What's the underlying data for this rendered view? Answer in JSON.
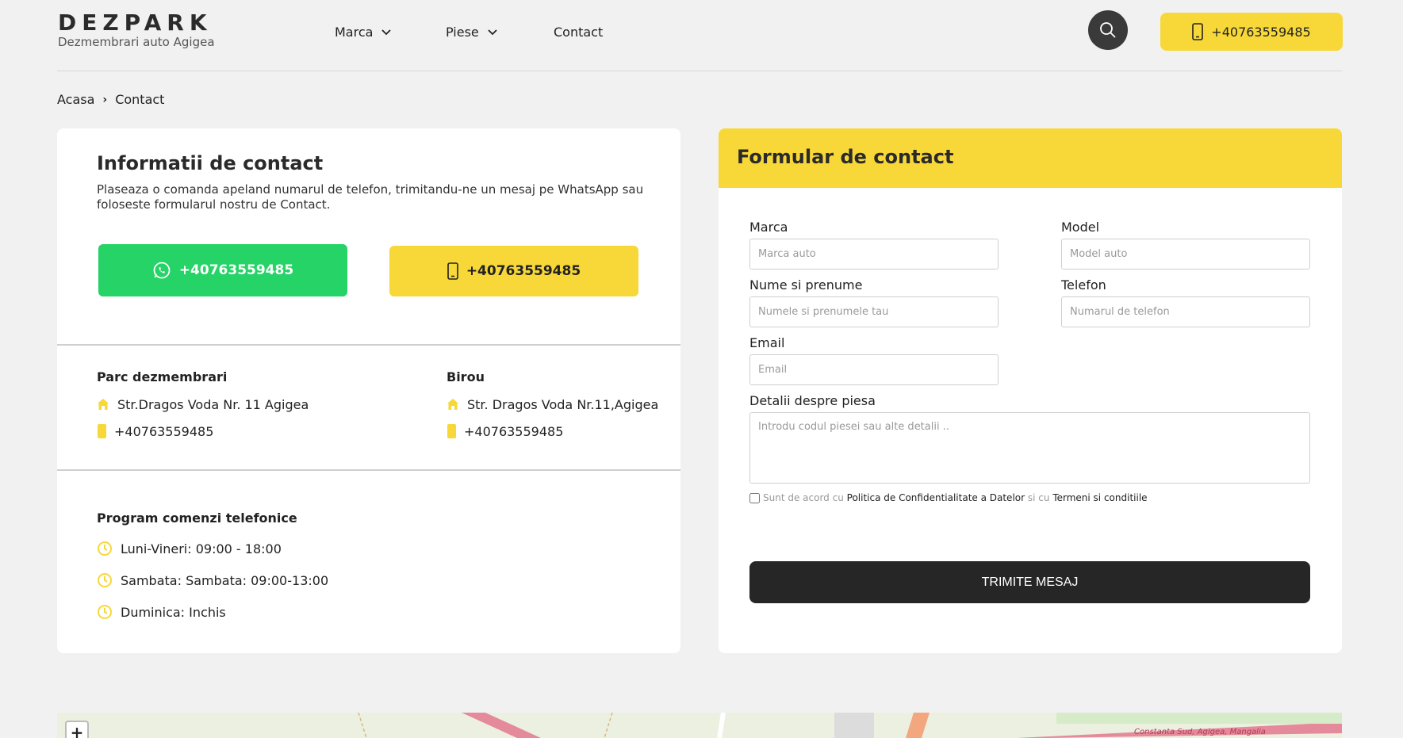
{
  "header": {
    "logo_title": "DEZPARK",
    "logo_subtitle": "Dezmembrari auto Agigea",
    "nav": [
      {
        "label": "Marca",
        "has_dropdown": true
      },
      {
        "label": "Piese",
        "has_dropdown": true
      },
      {
        "label": "Contact",
        "has_dropdown": false
      }
    ],
    "phone": "+40763559485"
  },
  "breadcrumb": {
    "home": "Acasa",
    "current": "Contact"
  },
  "contact_info": {
    "title": "Informatii de contact",
    "description": "Plaseaza o comanda apeland numarul de telefon, trimitandu-ne un mesaj pe WhatsApp sau foloseste formularul nostru de Contact.",
    "whatsapp_label": "+40763559485",
    "call_label": "+40763559485",
    "locations": [
      {
        "title": "Parc dezmembrari",
        "address": "Str.Dragos Voda Nr. 11 Agigea",
        "phone": "+40763559485"
      },
      {
        "title": "Birou",
        "address": "Str. Dragos Voda Nr.11,Agigea",
        "phone": "+40763559485"
      }
    ],
    "hours_title": "Program comenzi telefonice",
    "hours": [
      "Luni-Vineri: 09:00 - 18:00",
      "Sambata: Sambata: 09:00-13:00",
      "Duminica: Inchis"
    ]
  },
  "form": {
    "title": "Formular de contact",
    "fields": {
      "marca": {
        "label": "Marca",
        "placeholder": "Marca auto",
        "value": ""
      },
      "model": {
        "label": "Model",
        "placeholder": "Model auto",
        "value": ""
      },
      "name": {
        "label": "Nume si prenume",
        "placeholder": "Numele si prenumele tau",
        "value": ""
      },
      "phone": {
        "label": "Telefon",
        "placeholder": "Numarul de telefon",
        "value": ""
      },
      "email": {
        "label": "Email",
        "placeholder": "Email",
        "value": ""
      },
      "details": {
        "label": "Detalii despre piesa",
        "placeholder": "Introdu codul piesei sau alte detalii ..",
        "value": ""
      }
    },
    "consent": {
      "prefix": "Sunt de acord cu",
      "privacy_link": "Politica de Confidentialitate a Datelor",
      "middle": "si cu",
      "terms_link": "Termeni si conditiile",
      "checked": false
    },
    "submit_label": "TRIMITE MESAJ"
  },
  "map": {
    "zoom_in_label": "+",
    "road_label": "Constanta Sud, Agigea, Mangalia"
  },
  "colors": {
    "accent_yellow": "#f7d838",
    "whatsapp_green": "#25d366",
    "dark_button": "#262626",
    "background": "#f1f1f1"
  }
}
